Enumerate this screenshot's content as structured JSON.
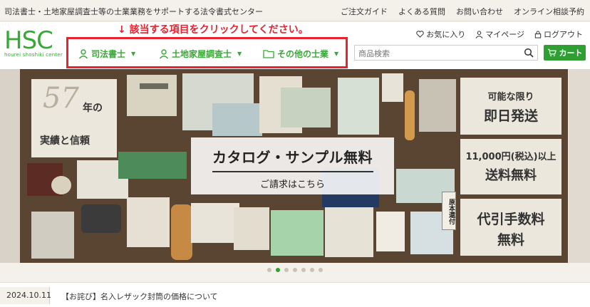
{
  "topbar": {
    "tagline": "司法書士・土地家屋調査士等の士業業務をサポートする法令書式センター",
    "links": [
      "ご注文ガイド",
      "よくある質問",
      "お問い合わせ",
      "オンライン相談予約"
    ]
  },
  "header": {
    "logo_mark": "HSC",
    "logo_sub": "hourei shoshiki center",
    "instruction": "↓ 該当する項目をクリックしてください。",
    "categories": [
      "司法書士",
      "土地家屋調査士",
      "その他の士業"
    ],
    "account": {
      "favorites": "お気に入り",
      "mypage": "マイページ",
      "logout": "ログアウト"
    },
    "search_placeholder": "商品検索",
    "cart_label": "カート"
  },
  "hero": {
    "years_num": "57",
    "years_suffix": "年の",
    "years_text": "実績と信頼",
    "catalog_title": "カタログ・サンプル無料",
    "catalog_sub": "ご請求はこちら",
    "promo1_l1": "可能な限り",
    "promo1_l2": "即日発送",
    "promo2_l1": "11,000円(税込)以上",
    "promo2_l2": "送料無料",
    "promo3_l1": "代引手数料",
    "promo3_l2": "無料",
    "stamp_text": "原本還付"
  },
  "carousel": {
    "count": 7,
    "active_index": 1
  },
  "news": {
    "date": "2024.10.11",
    "title": "【お詫び】名入レザック封筒の価格について"
  },
  "colors": {
    "brand_green": "#3aa837",
    "cart_green": "#2f9f34",
    "highlight_red": "#e8222e"
  }
}
